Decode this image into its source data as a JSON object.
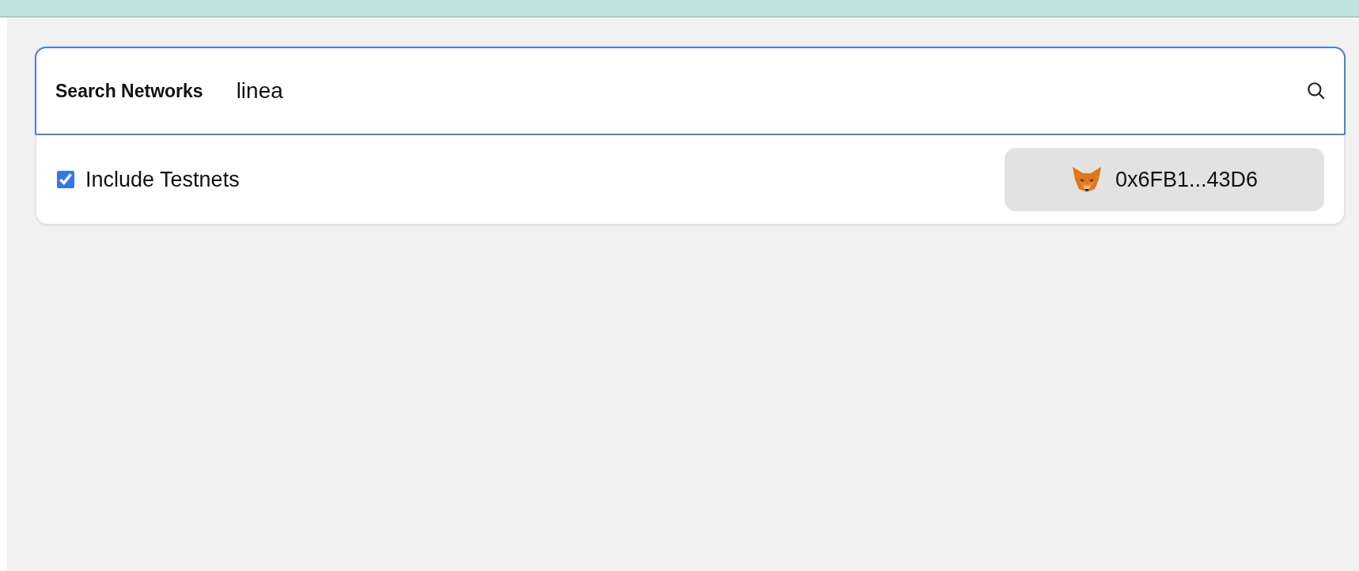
{
  "search": {
    "label": "Search Networks",
    "value": "linea"
  },
  "testnets": {
    "label": "Include Testnets",
    "checked": true
  },
  "account": {
    "address": "0x6FB1...43D6"
  }
}
